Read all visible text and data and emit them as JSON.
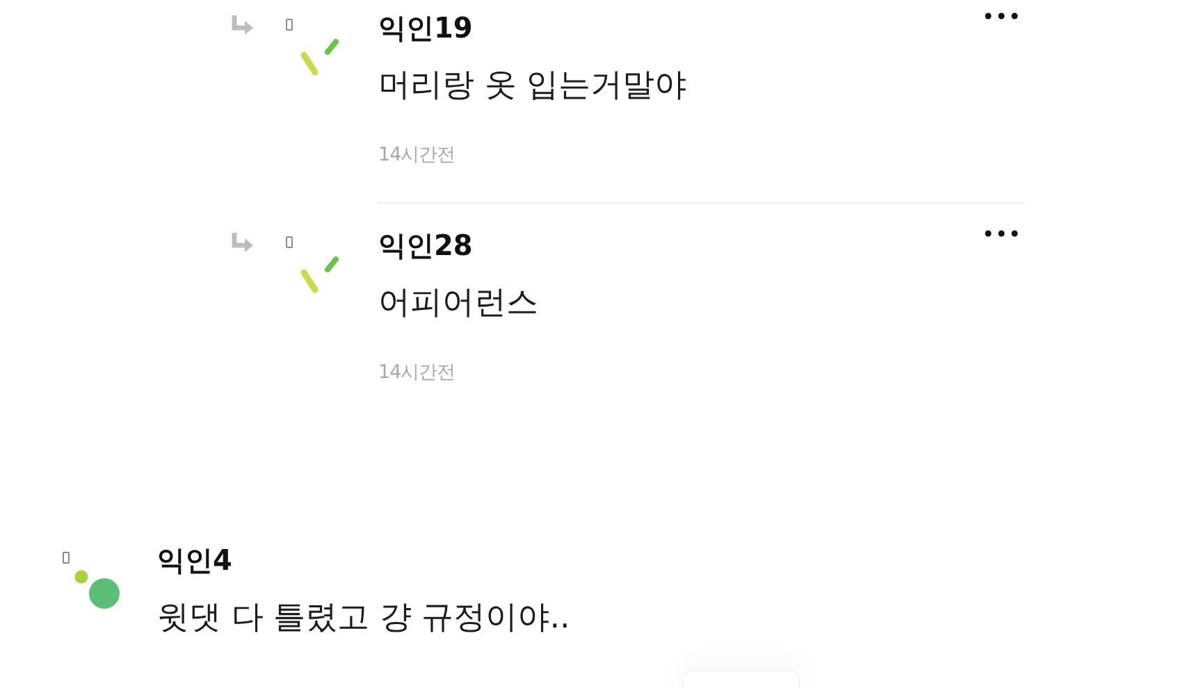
{
  "comments": [
    {
      "kind": "reply",
      "author": "익인19",
      "text": "머리랑 옷 입는거말야",
      "time": "14시간전"
    },
    {
      "kind": "reply",
      "author": "익인28",
      "text": "어피어런스",
      "time": "14시간전"
    },
    {
      "kind": "comment",
      "author": "익인4",
      "text": "윗댓 다 틀렸고 걍 규정이야.."
    }
  ]
}
